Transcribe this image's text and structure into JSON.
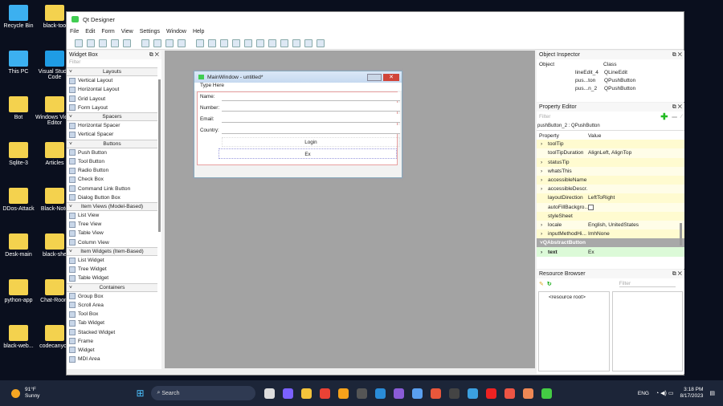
{
  "desktop": {
    "icons_col1": [
      "Recycle Bin",
      "This PC",
      "Bot",
      "Sqlite-3",
      "DDos-Attack",
      "Desk-main",
      "python-app",
      "black-web..."
    ],
    "icons_col2": [
      "black-too",
      "Visual Studio Code",
      "Windows Video Editor",
      "Articles",
      "Black-Note",
      "black-she",
      "Chat-Room",
      "codecanyon"
    ]
  },
  "app": {
    "title": "Qt Designer",
    "menu": [
      "File",
      "Edit",
      "Form",
      "View",
      "Settings",
      "Window",
      "Help"
    ]
  },
  "widget_box": {
    "title": "Widget Box",
    "filter_placeholder": "Filter",
    "groups": [
      {
        "name": "Layouts",
        "items": [
          "Vertical Layout",
          "Horizontal Layout",
          "Grid Layout",
          "Form Layout"
        ]
      },
      {
        "name": "Spacers",
        "items": [
          "Horizontal Spacer",
          "Vertical Spacer"
        ]
      },
      {
        "name": "Buttons",
        "items": [
          "Push Button",
          "Tool Button",
          "Radio Button",
          "Check Box",
          "Command Link Button",
          "Dialog Button Box"
        ]
      },
      {
        "name": "Item Views (Model-Based)",
        "items": [
          "List View",
          "Tree View",
          "Table View",
          "Column View"
        ]
      },
      {
        "name": "Item Widgets (Item-Based)",
        "items": [
          "List Widget",
          "Tree Widget",
          "Table Widget"
        ]
      },
      {
        "name": "Containers",
        "items": [
          "Group Box",
          "Scroll Area",
          "Tool Box",
          "Tab Widget",
          "Stacked Widget",
          "Frame",
          "Widget",
          "MDI Area"
        ]
      }
    ]
  },
  "form": {
    "title": "MainWindow - untitled*",
    "menu_placeholder": "Type Here",
    "labels": [
      "Name:",
      "Number:",
      "Email:",
      "Country:"
    ],
    "login_button": "Login",
    "editing_button_text": "Ex"
  },
  "object_inspector": {
    "title": "Object Inspector",
    "headers": [
      "Object",
      "Class"
    ],
    "rows": [
      [
        "lineEdit_4",
        "QLineEdit"
      ],
      [
        "pus...ton",
        "QPushButton"
      ],
      [
        "pus...n_2",
        "QPushButton"
      ]
    ]
  },
  "property_editor": {
    "title": "Property Editor",
    "filter_placeholder": "Filter",
    "selected": "pushButton_2 : QPushButton",
    "headers": [
      "Property",
      "Value"
    ],
    "rows": [
      [
        "toolTip",
        ""
      ],
      [
        "toolTipDuration",
        "AlignLeft, AlignTop"
      ],
      [
        "statusTip",
        ""
      ],
      [
        "whatsThis",
        ""
      ],
      [
        "accessibleName",
        ""
      ],
      [
        "accessibleDescr...",
        ""
      ],
      [
        "layoutDirection",
        "LeftToRight"
      ],
      [
        "autoFillBackgro...",
        ""
      ],
      [
        "styleSheet",
        ""
      ],
      [
        "locale",
        "English, UnitedStates"
      ],
      [
        "inputMethodHi...",
        "ImhNone"
      ]
    ],
    "section": "QAbstractButton",
    "text_prop": [
      "text",
      "Ex"
    ]
  },
  "resource_browser": {
    "title": "Resource Browser",
    "filter_placeholder": "Filter",
    "root": "<resource root>"
  },
  "taskbar": {
    "weather_temp": "91°F",
    "weather_desc": "Sunny",
    "search": "Search",
    "lang": "ENG",
    "time": "3:18 PM",
    "date": "8/17/2023"
  }
}
